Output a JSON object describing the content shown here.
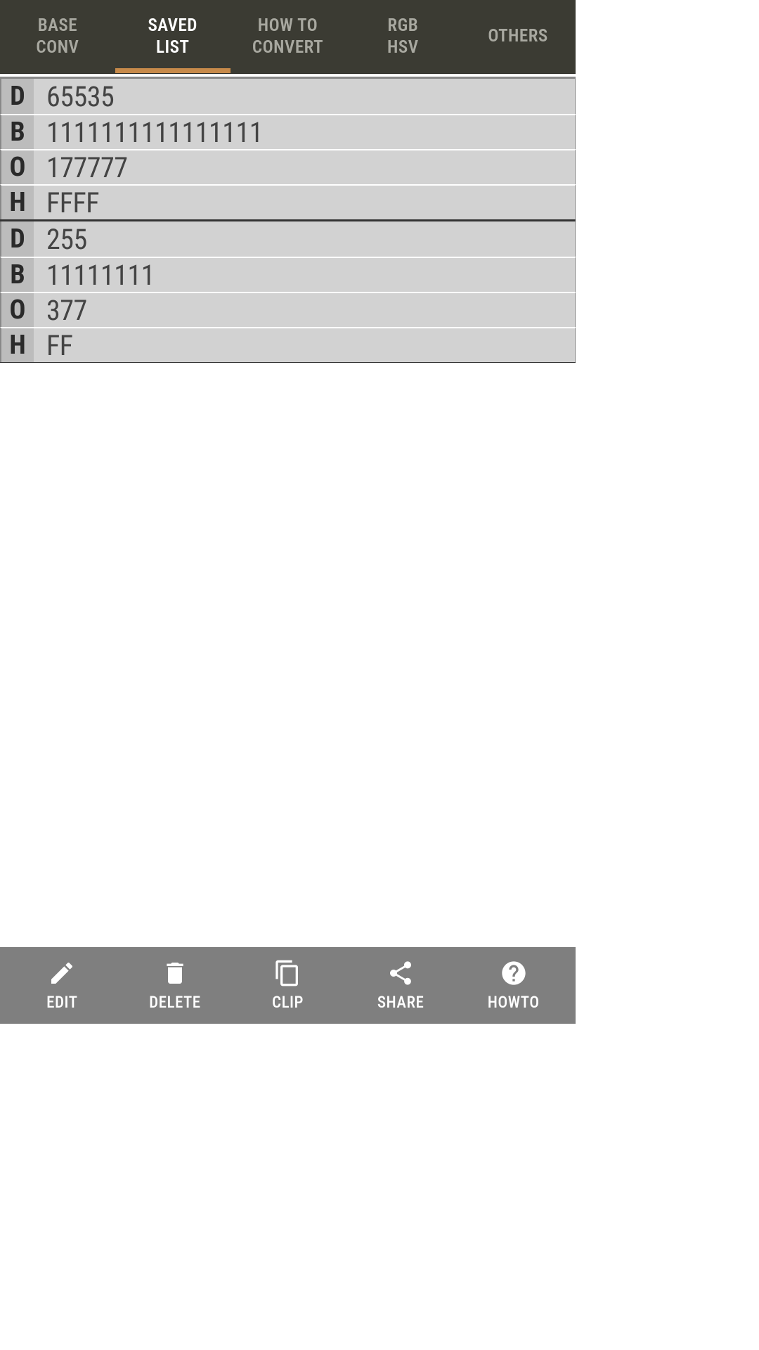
{
  "tabs": [
    {
      "line1": "BASE",
      "line2": "CONV",
      "active": false
    },
    {
      "line1": "SAVED",
      "line2": "LIST",
      "active": true
    },
    {
      "line1": "HOW TO",
      "line2": "CONVERT",
      "active": false
    },
    {
      "line1": "RGB",
      "line2": "HSV",
      "active": false
    },
    {
      "line1": "OTHERS",
      "line2": "",
      "active": false
    }
  ],
  "entries": [
    {
      "rows": [
        {
          "base": "D",
          "value": "65535"
        },
        {
          "base": "B",
          "value": "1111111111111111"
        },
        {
          "base": "O",
          "value": "177777"
        },
        {
          "base": "H",
          "value": "FFFF"
        }
      ]
    },
    {
      "rows": [
        {
          "base": "D",
          "value": "255"
        },
        {
          "base": "B",
          "value": "11111111"
        },
        {
          "base": "O",
          "value": "377"
        },
        {
          "base": "H",
          "value": "FF"
        }
      ]
    }
  ],
  "actions": [
    {
      "id": "edit",
      "label": "EDIT"
    },
    {
      "id": "delete",
      "label": "DELETE"
    },
    {
      "id": "clip",
      "label": "CLIP"
    },
    {
      "id": "share",
      "label": "SHARE"
    },
    {
      "id": "howto",
      "label": "HOWTO"
    }
  ]
}
